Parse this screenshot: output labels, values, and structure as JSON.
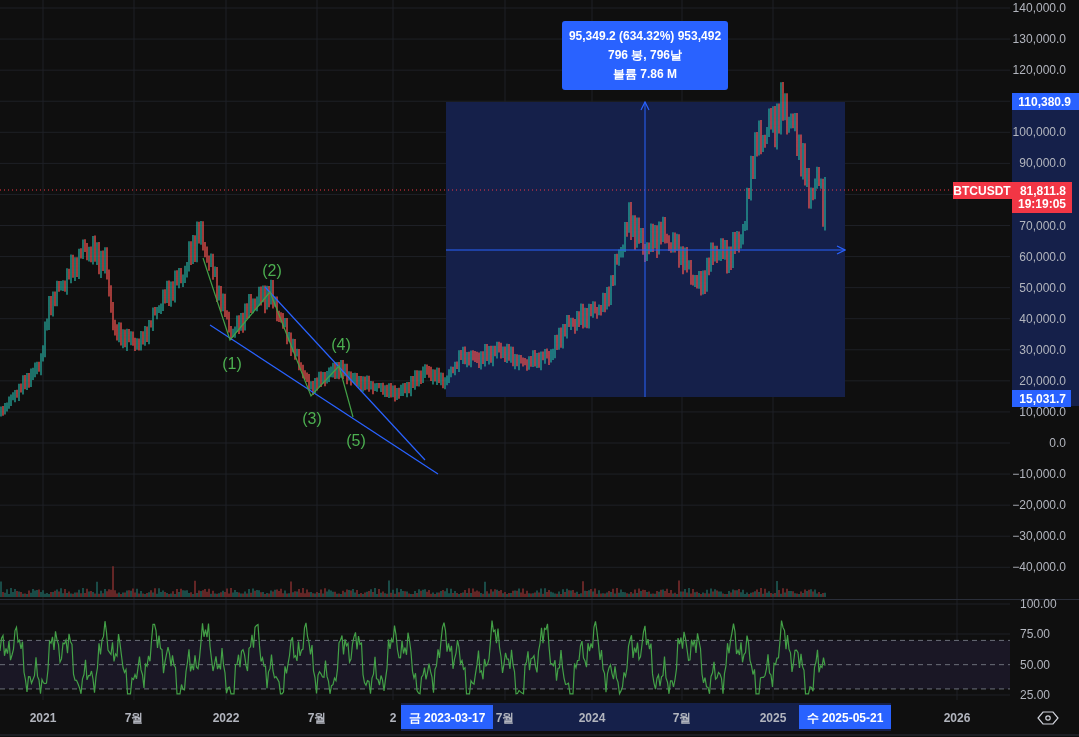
{
  "chart": {
    "symbol_label": "BTCUSDT",
    "last_price": "81,811.8",
    "countdown": "19:19:05",
    "range_high": "110,380.9",
    "range_low": "15,031.7",
    "price_ticks": [
      "140,000.0",
      "130,000.0",
      "120,000.0",
      "100,000.0",
      "90,000.0",
      "70,000.0",
      "60,000.0",
      "50,000.0",
      "40,000.0",
      "30,000.0",
      "20,000.0",
      "10,000.0",
      "0.0",
      "−10,000.0",
      "−20,000.0",
      "−30,000.0",
      "−40,000.0"
    ],
    "measure_tooltip": [
      "95,349.2 (634.32%) 953,492",
      "796 봉, 796날",
      "볼륨 7.86 M"
    ],
    "wave_labels": [
      "(1)",
      "(2)",
      "(3)",
      "(4)",
      "(5)"
    ]
  },
  "rsi_pane": {
    "ticks": [
      "100.00",
      "75.00",
      "50.00",
      "25.00"
    ]
  },
  "time_axis": {
    "labels": [
      "2021",
      "7월",
      "2022",
      "7월",
      "2",
      "7월",
      "2024",
      "7월",
      "2025",
      "2026"
    ],
    "range_start": "금 2023-03-17",
    "range_end": "수 2025-05-21"
  }
}
